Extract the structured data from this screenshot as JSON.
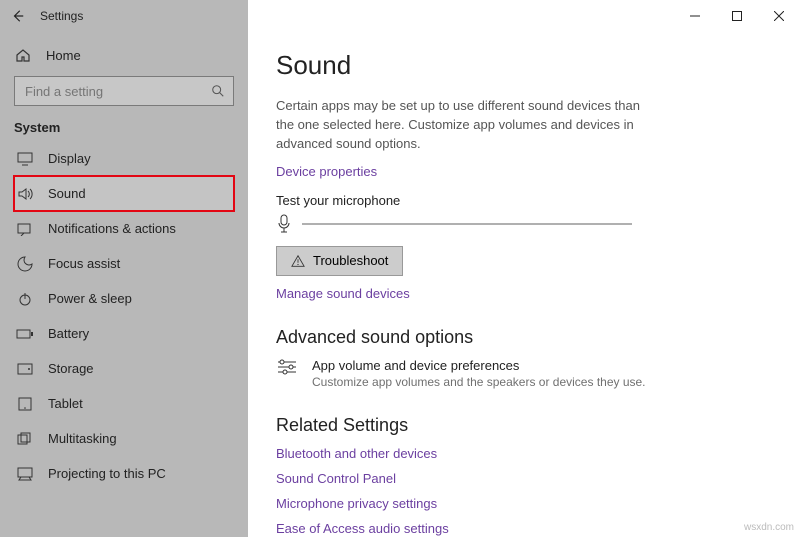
{
  "titlebar": {
    "app_name": "Settings"
  },
  "sidebar": {
    "home_label": "Home",
    "search_placeholder": "Find a setting",
    "section_label": "System",
    "items": [
      {
        "label": "Display"
      },
      {
        "label": "Sound"
      },
      {
        "label": "Notifications & actions"
      },
      {
        "label": "Focus assist"
      },
      {
        "label": "Power & sleep"
      },
      {
        "label": "Battery"
      },
      {
        "label": "Storage"
      },
      {
        "label": "Tablet"
      },
      {
        "label": "Multitasking"
      },
      {
        "label": "Projecting to this PC"
      }
    ]
  },
  "main": {
    "title": "Sound",
    "description": "Certain apps may be set up to use different sound devices than the one selected here. Customize app volumes and devices in advanced sound options.",
    "device_properties_link": "Device properties",
    "test_mic_label": "Test your microphone",
    "troubleshoot_label": "Troubleshoot",
    "manage_devices_link": "Manage sound devices",
    "advanced_heading": "Advanced sound options",
    "advanced_item_title": "App volume and device preferences",
    "advanced_item_sub": "Customize app volumes and the speakers or devices they use.",
    "related_heading": "Related Settings",
    "related_links": [
      "Bluetooth and other devices",
      "Sound Control Panel",
      "Microphone privacy settings",
      "Ease of Access audio settings"
    ]
  },
  "watermark": "wsxdn.com"
}
